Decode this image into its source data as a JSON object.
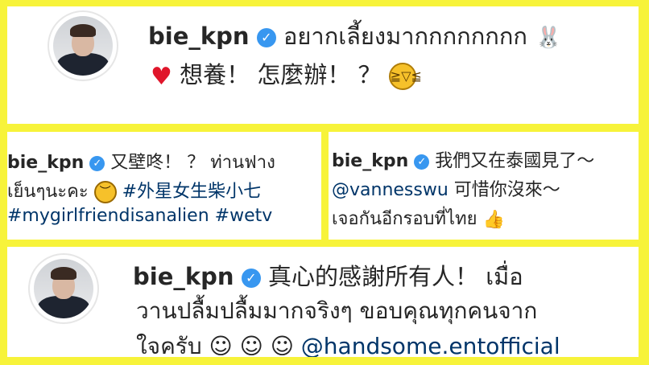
{
  "posts": [
    {
      "username": "bie_kpn",
      "line1_text": "อยากเลี้ยงมากกกกกกกก",
      "rabbit_icon": "rabbit-face-icon",
      "heart_icon": "red-heart-icon",
      "line2_text": "想養！ 怎麼辦！ ？",
      "laugh_icon": "laughing-face-icon"
    },
    {
      "username": "bie_kpn",
      "line1_text": "又壁咚！ ？ ท่านฟาง",
      "line2_text": "เย็นๆนะคะ",
      "sad_icon": "frowning-face-icon",
      "hashtag1": "#外星女生柴小七",
      "hashtag2": "#mygirlfriendisanalien",
      "hashtag3": "#wetv"
    },
    {
      "username": "bie_kpn",
      "line1_text": "我們又在泰國見了～",
      "mention": "@vannesswu",
      "line2_text": "可惜你沒來～",
      "line3_text": "เจอกันอีกรอบที่ไทย",
      "thumb_icon": "thumbs-up-icon"
    },
    {
      "username": "bie_kpn",
      "line1_text": "真心的感謝所有人！ เมื่อ",
      "line2_text": "วานปลื้มปลื้มมากจริงๆ ขอบคุณทุกคนจาก",
      "line3_text": "ใจครับ ☺ ☺ ☺",
      "mention": "@handsome.entofficial"
    }
  ],
  "colors": {
    "frame": "#f7f33a",
    "verified": "#3897f0",
    "link": "#003569",
    "text": "#262626"
  }
}
